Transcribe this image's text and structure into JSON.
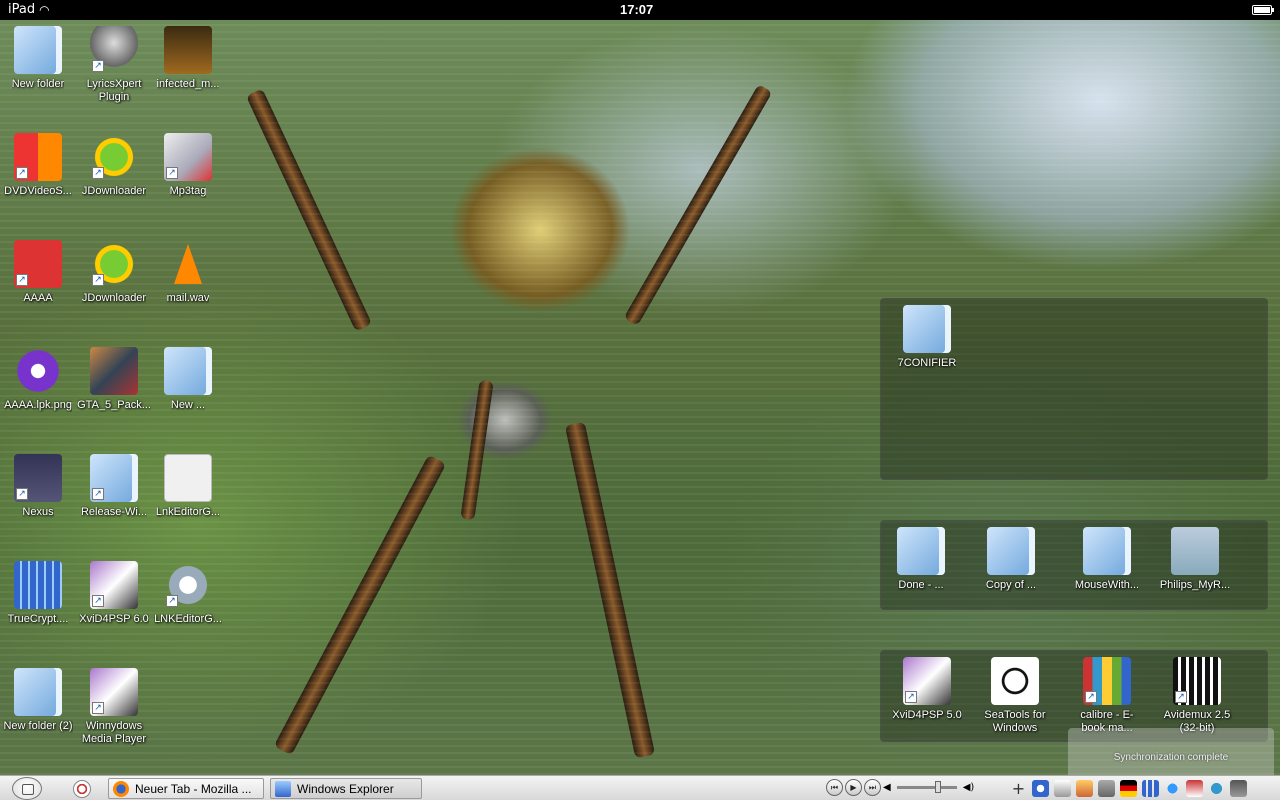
{
  "status_bar": {
    "device": "iPad",
    "time": "17:07"
  },
  "desktop_icons": [
    {
      "label": "New folder"
    },
    {
      "label": "LyricsXpert Plugin"
    },
    {
      "label": "infected_m..."
    },
    {
      "label": "DVDVideoS..."
    },
    {
      "label": "JDownloader"
    },
    {
      "label": "Mp3tag"
    },
    {
      "label": "AAAA"
    },
    {
      "label": "JDownloader"
    },
    {
      "label": "mail.wav"
    },
    {
      "label": "AAAA.lpk.png"
    },
    {
      "label": "GTA_5_Pack..."
    },
    {
      "label": "New ..."
    },
    {
      "label": "Nexus"
    },
    {
      "label": "Release-Wi..."
    },
    {
      "label": "LnkEditorG..."
    },
    {
      "label": "TrueCrypt...."
    },
    {
      "label": "XviD4PSP 6.0"
    },
    {
      "label": "LNKEditorG..."
    },
    {
      "label": "New folder (2)"
    },
    {
      "label": "Winnydows Media Player"
    }
  ],
  "fences": {
    "top": {
      "items": [
        {
          "label": "7CONIFIER"
        }
      ]
    },
    "middle": {
      "items": [
        {
          "label": "Done - ..."
        },
        {
          "label": "Copy of ..."
        },
        {
          "label": "MouseWith..."
        },
        {
          "label": "Philips_MyR..."
        }
      ]
    },
    "bottom": {
      "items": [
        {
          "label": "XviD4PSP 5.0"
        },
        {
          "label": "SeaTools for Windows"
        },
        {
          "label": "calibre - E-book ma..."
        },
        {
          "label": "Avidemux 2.5 (32-bit)"
        }
      ]
    }
  },
  "notification": {
    "text": "Synchronization complete"
  },
  "taskbar": {
    "buttons": [
      {
        "label": "Neuer Tab - Mozilla ...",
        "icon": "firefox-icon"
      },
      {
        "label": "Windows Explorer",
        "icon": "explorer-icon"
      }
    ],
    "media": {
      "prev": "⏮",
      "play": "▶",
      "next": "⏭"
    }
  },
  "colors": {
    "taskbar_bg": "#e4e4e4",
    "fence_bg": "rgba(20,25,20,0.35)"
  }
}
